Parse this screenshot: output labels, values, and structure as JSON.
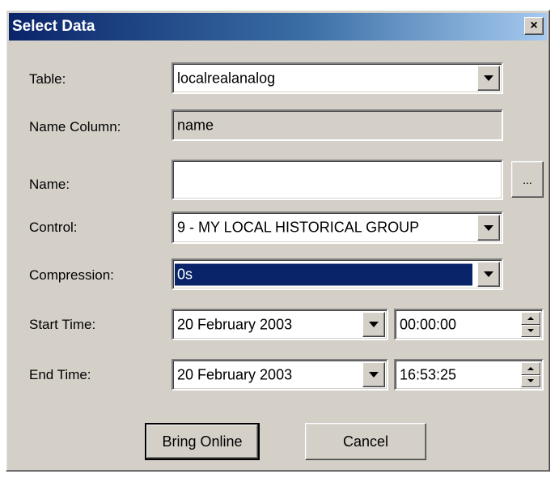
{
  "dialog": {
    "title": "Select Data",
    "close_label": "×"
  },
  "fields": {
    "table": {
      "label": "Table:",
      "value": "localrealanalog"
    },
    "name_column": {
      "label": "Name Column:",
      "value": "name"
    },
    "name": {
      "label": "Name:",
      "value": "",
      "browse_label": "..."
    },
    "control": {
      "label": "Control:",
      "value": "9 - MY LOCAL HISTORICAL GROUP"
    },
    "compression": {
      "label": "Compression:",
      "value": "0s"
    },
    "start_time": {
      "label": "Start Time:",
      "date": "20  February  2003",
      "time": "00:00:00"
    },
    "end_time": {
      "label": "End Time:",
      "date": "20  February  2003",
      "time": "16:53:25"
    }
  },
  "buttons": {
    "bring_online": "Bring Online",
    "cancel": "Cancel"
  },
  "colors": {
    "titlebar_start": "#0a246a",
    "titlebar_end": "#a6caf0",
    "face": "#d4d0c8",
    "selection": "#0a246a"
  }
}
